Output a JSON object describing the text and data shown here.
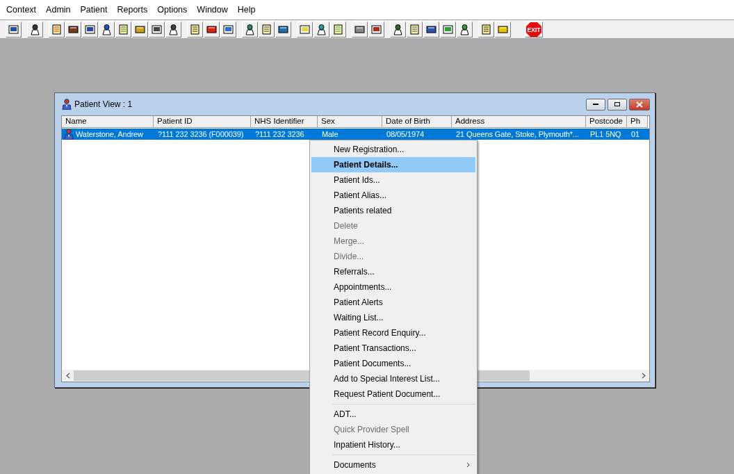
{
  "menu_bar": [
    "Context",
    "Admin",
    "Patient",
    "Reports",
    "Options",
    "Window",
    "Help"
  ],
  "toolbar": {
    "exit_label": "EXIT"
  },
  "window": {
    "title": "Patient View : 1"
  },
  "table": {
    "columns": [
      "Name",
      "Patient ID",
      "NHS Identifier",
      "Sex",
      "Date of Birth",
      "Address",
      "Postcode",
      "Ph"
    ],
    "rows": [
      {
        "selected": true,
        "cells": [
          "Waterstone, Andrew",
          "?111 232 3236 (F000039)",
          "?111 232 3236",
          "Male",
          "08/05/1974",
          "21 Queens Gate, Stoke, Plymouth*...",
          "PL1 5NQ",
          "01"
        ]
      }
    ]
  },
  "context_menu": [
    {
      "kind": "item",
      "label": "New Registration...",
      "disabled": false,
      "selected": false
    },
    {
      "kind": "item",
      "label": "Patient Details...",
      "disabled": false,
      "selected": true
    },
    {
      "kind": "item",
      "label": "Patient Ids...",
      "disabled": false,
      "selected": false
    },
    {
      "kind": "item",
      "label": "Patient Alias...",
      "disabled": false,
      "selected": false
    },
    {
      "kind": "item",
      "label": "Patients related",
      "disabled": false,
      "selected": false
    },
    {
      "kind": "item",
      "label": "Delete",
      "disabled": true,
      "selected": false
    },
    {
      "kind": "item",
      "label": "Merge...",
      "disabled": true,
      "selected": false
    },
    {
      "kind": "item",
      "label": "Divide...",
      "disabled": true,
      "selected": false
    },
    {
      "kind": "item",
      "label": "Referrals...",
      "disabled": false,
      "selected": false
    },
    {
      "kind": "item",
      "label": "Appointments...",
      "disabled": false,
      "selected": false
    },
    {
      "kind": "item",
      "label": "Patient Alerts",
      "disabled": false,
      "selected": false
    },
    {
      "kind": "item",
      "label": "Waiting List...",
      "disabled": false,
      "selected": false
    },
    {
      "kind": "item",
      "label": "Patient Record Enquiry...",
      "disabled": false,
      "selected": false
    },
    {
      "kind": "item",
      "label": "Patient Transactions...",
      "disabled": false,
      "selected": false
    },
    {
      "kind": "item",
      "label": "Patient Documents...",
      "disabled": false,
      "selected": false
    },
    {
      "kind": "item",
      "label": "Add to Special Interest List...",
      "disabled": false,
      "selected": false
    },
    {
      "kind": "item",
      "label": "Request Patient Document...",
      "disabled": false,
      "selected": false
    },
    {
      "kind": "separator"
    },
    {
      "kind": "item",
      "label": "ADT...",
      "disabled": false,
      "selected": false
    },
    {
      "kind": "item",
      "label": "Quick Provider Spell",
      "disabled": true,
      "selected": false
    },
    {
      "kind": "item",
      "label": "Inpatient History...",
      "disabled": false,
      "selected": false
    },
    {
      "kind": "separator"
    },
    {
      "kind": "submenu",
      "label": "Documents",
      "disabled": false,
      "selected": false
    }
  ]
}
